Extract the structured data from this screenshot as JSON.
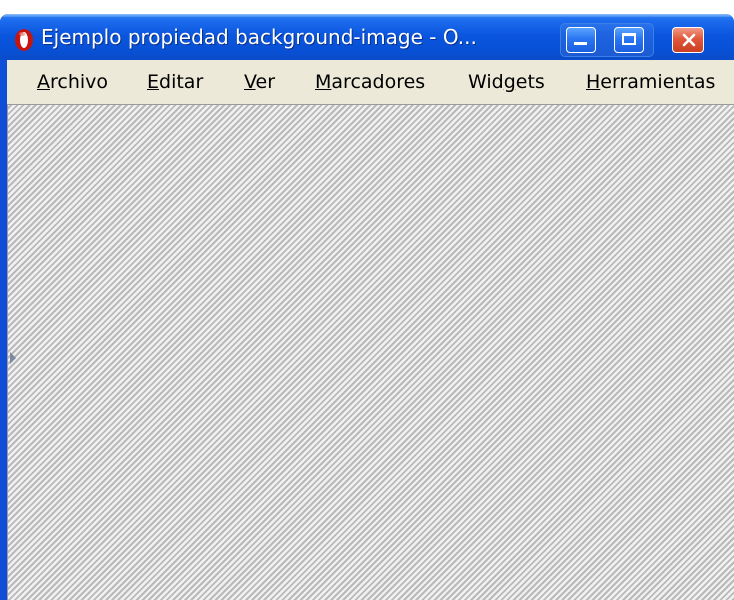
{
  "window": {
    "title": "Ejemplo propiedad background-image - O...",
    "app_icon": "opera-icon",
    "controls": {
      "minimize": "minimize-icon",
      "maximize": "maximize-icon",
      "close": "close-icon"
    },
    "colors": {
      "titlebar": "#0b56de",
      "close_button": "#e2573a",
      "menubar": "#ece9d8",
      "stripe_dark": "#b9b9b9",
      "stripe_light": "#f1f1f1"
    }
  },
  "menubar": {
    "items": [
      {
        "mnemonic": "A",
        "rest": "rchivo"
      },
      {
        "mnemonic": "E",
        "rest": "ditar"
      },
      {
        "mnemonic": "V",
        "rest": "er"
      },
      {
        "mnemonic": "M",
        "rest": "arcadores"
      },
      {
        "pre": "Wid",
        "mnemonic": "g",
        "rest": "ets"
      },
      {
        "mnemonic": "H",
        "rest": "erramientas"
      }
    ]
  }
}
